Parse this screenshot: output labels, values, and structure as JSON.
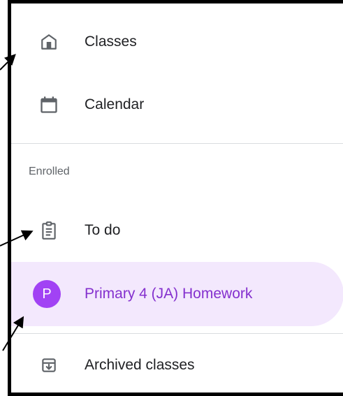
{
  "nav": {
    "items": [
      {
        "label": "Classes",
        "icon": "home-icon"
      },
      {
        "label": "Calendar",
        "icon": "calendar-icon"
      }
    ]
  },
  "enrolled": {
    "section_title": "Enrolled",
    "todo_label": "To do",
    "class": {
      "avatar_letter": "P",
      "name": "Primary 4 (JA) Homework",
      "avatar_color": "#a142f4",
      "highlight_color": "#f3e8fd",
      "text_color": "#8430ce"
    }
  },
  "archived": {
    "label": "Archived classes"
  }
}
